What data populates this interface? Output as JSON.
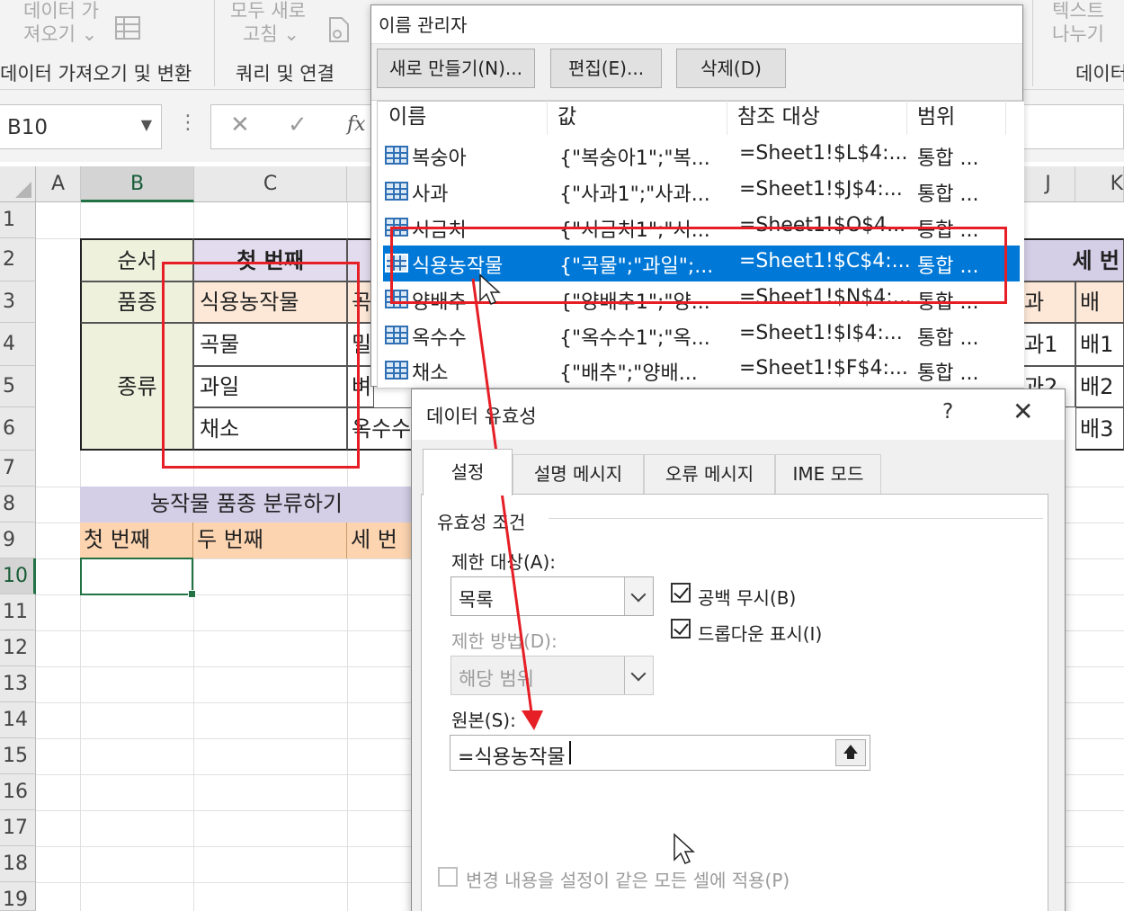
{
  "ribbon": {
    "get_data_lines": [
      "데이터 가",
      "져오기 ⌄"
    ],
    "refresh_lines": [
      "모두 새로",
      "고침 ⌄"
    ],
    "text_to_columns_lines": [
      "텍스트",
      "나누기"
    ],
    "group_get_transform": "데이터 가져오기 및 변환",
    "group_queries": "쿼리 및 연결",
    "group_data_tools": "데이터"
  },
  "formula_bar": {
    "name_box": "B10",
    "fx": "fx"
  },
  "sheet": {
    "columns": [
      "A",
      "B",
      "C",
      "J",
      "K"
    ],
    "rows": [
      "1",
      "2",
      "3",
      "4",
      "5",
      "6",
      "7",
      "8",
      "9",
      "10",
      "11",
      "12",
      "13",
      "14",
      "15",
      "16",
      "17",
      "18",
      "19"
    ],
    "table1": {
      "order_label": "순서",
      "first": "첫 번째",
      "variety_label": "품종",
      "crop": "식용농작물",
      "kind_label": "종류",
      "grain": "곡물",
      "fruit": "과일",
      "vegetable": "채소",
      "c3_partial": "곡",
      "c4_partial": "밀",
      "c5_partial": "벼",
      "c6_partial": "옥수수"
    },
    "right_partial": {
      "third_partial": "세 번",
      "j3": "과",
      "k3": "배",
      "j4": "과1",
      "k4": "배1",
      "j5": "과2",
      "k5": "배2",
      "k6": "배3"
    },
    "table2": {
      "title": "농작물 품종 분류하기",
      "h1": "첫 번째",
      "h2": "두 번째",
      "h3": "세 번"
    }
  },
  "name_manager": {
    "title": "이름 관리자",
    "buttons": {
      "new": "새로 만들기(N)...",
      "edit": "편집(E)...",
      "delete": "삭제(D)"
    },
    "headers": {
      "name": "이름",
      "value": "값",
      "refers_to": "참조 대상",
      "scope": "범위"
    },
    "rows": [
      {
        "name": "복숭아",
        "value": "{\"복숭아1\";\"복...",
        "ref": "=Sheet1!$L$4:...",
        "scope": "통합 ..."
      },
      {
        "name": "사과",
        "value": "{\"사과1\";\"사과...",
        "ref": "=Sheet1!$J$4:...",
        "scope": "통합 ..."
      },
      {
        "name": "시금치",
        "value": "{\"시금치1\";\"시...",
        "ref": "=Sheet1!$O$4...",
        "scope": "통합 ..."
      },
      {
        "name": "식용농작물",
        "value": "{\"곡물\";\"과일\";...",
        "ref": "=Sheet1!$C$4:...",
        "scope": "통합 ..."
      },
      {
        "name": "양배추",
        "value": "{\"양배추1\";\"양...",
        "ref": "=Sheet1!$N$4:...",
        "scope": "통합 ..."
      },
      {
        "name": "옥수수",
        "value": "{\"옥수수1\";\"옥...",
        "ref": "=Sheet1!$I$4:...",
        "scope": "통합 ..."
      },
      {
        "name": "채소",
        "value": "{\"배추\";\"양배...",
        "ref": "=Sheet1!$F$4:...",
        "scope": "통합 ..."
      }
    ],
    "selected_index": 3
  },
  "data_validation": {
    "title": "데이터 유효성",
    "help": "?",
    "close": "✕",
    "tabs": [
      "설정",
      "설명 메시지",
      "오류 메시지",
      "IME 모드"
    ],
    "section": "유효성 조건",
    "allow_label": "제한 대상(A):",
    "allow_value": "목록",
    "data_label": "제한 방법(D):",
    "data_value": "해당 범위",
    "ignore_blank": "공백 무시(B)",
    "dropdown": "드롭다운 표시(I)",
    "source_label": "원본(S):",
    "source_value": "=식용농작물",
    "apply_all": "변경 내용을 설정이 같은 모든 셀에 적용(P)"
  },
  "colors": {
    "accent": "#217346",
    "selection": "#0078d7",
    "annotation": "#e61e25"
  }
}
